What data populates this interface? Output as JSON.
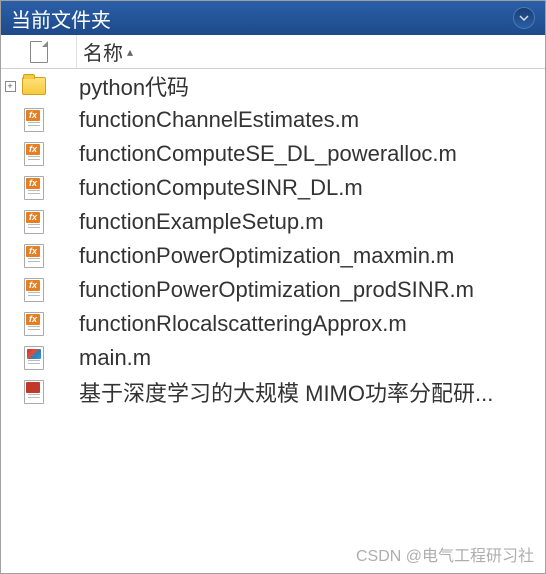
{
  "titlebar": {
    "title": "当前文件夹"
  },
  "header": {
    "name_label": "名称"
  },
  "items": [
    {
      "name": "python代码",
      "type": "folder",
      "expandable": true
    },
    {
      "name": "functionChannelEstimates.m",
      "type": "fx"
    },
    {
      "name": "functionComputeSE_DL_poweralloc.m",
      "type": "fx"
    },
    {
      "name": "functionComputeSINR_DL.m",
      "type": "fx"
    },
    {
      "name": "functionExampleSetup.m",
      "type": "fx"
    },
    {
      "name": "functionPowerOptimization_maxmin.m",
      "type": "fx"
    },
    {
      "name": "functionPowerOptimization_prodSINR.m",
      "type": "fx"
    },
    {
      "name": "functionRlocalscatteringApprox.m",
      "type": "fx"
    },
    {
      "name": "main.m",
      "type": "mfile"
    },
    {
      "name": "基于深度学习的大规模 MIMO功率分配研...",
      "type": "pdf"
    }
  ],
  "watermark": "CSDN @电气工程研习社"
}
